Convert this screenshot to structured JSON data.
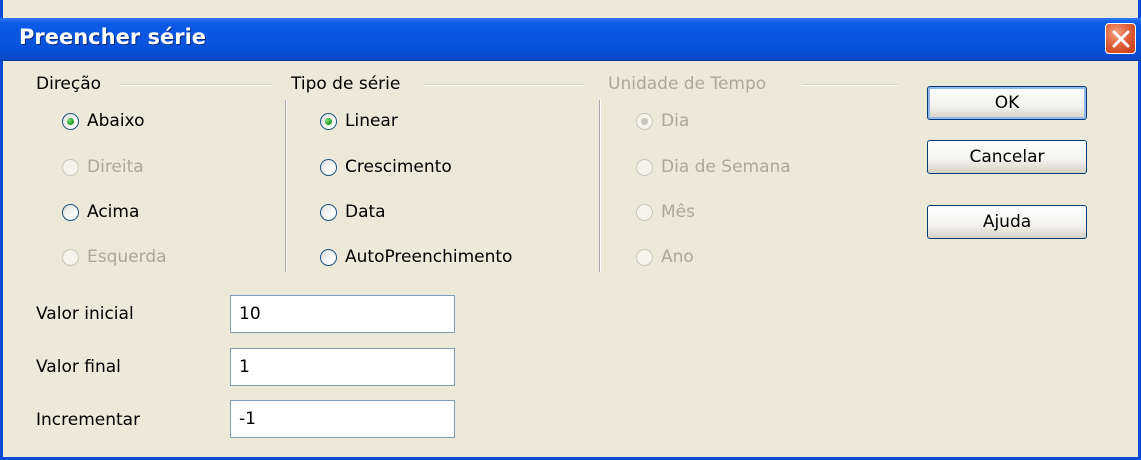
{
  "window": {
    "title": "Preencher série"
  },
  "direction_group": {
    "title": "Direção",
    "options": [
      {
        "label": "Abaixo",
        "checked": true,
        "enabled": true
      },
      {
        "label": "Direita",
        "checked": false,
        "enabled": false
      },
      {
        "label": "Acima",
        "checked": false,
        "enabled": true
      },
      {
        "label": "Esquerda",
        "checked": false,
        "enabled": false
      }
    ]
  },
  "series_type_group": {
    "title": "Tipo de série",
    "options": [
      {
        "label": "Linear",
        "checked": true,
        "enabled": true
      },
      {
        "label": "Crescimento",
        "checked": false,
        "enabled": true
      },
      {
        "label": "Data",
        "checked": false,
        "enabled": true
      },
      {
        "label": "AutoPreenchimento",
        "checked": false,
        "enabled": true
      }
    ]
  },
  "time_unit_group": {
    "title": "Unidade de Tempo",
    "options": [
      {
        "label": "Dia",
        "checked": true,
        "enabled": false
      },
      {
        "label": "Dia de Semana",
        "checked": false,
        "enabled": false
      },
      {
        "label": "Mês",
        "checked": false,
        "enabled": false
      },
      {
        "label": "Ano",
        "checked": false,
        "enabled": false
      }
    ]
  },
  "fields": {
    "start_value": {
      "label": "Valor inicial",
      "value": "10"
    },
    "end_value": {
      "label": "Valor final",
      "value": "1"
    },
    "increment": {
      "label": "Incrementar",
      "value": "-1"
    }
  },
  "buttons": {
    "ok": "OK",
    "cancel": "Cancelar",
    "help": "Ajuda"
  },
  "colors": {
    "titlebar": "#0a56e0",
    "dialog_bg": "#ece9d8",
    "close": "#e0603a"
  }
}
